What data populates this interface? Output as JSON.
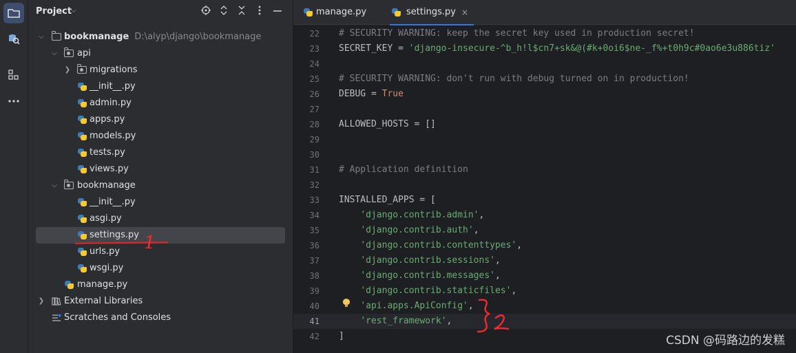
{
  "sidebar": {
    "title": "Project",
    "tree": [
      {
        "label": "bookmanage",
        "path": "D:\\alyp\\django\\bookmanage",
        "bold": true
      },
      {
        "label": "api"
      },
      {
        "label": "migrations"
      },
      {
        "label": "__init__.py"
      },
      {
        "label": "admin.py"
      },
      {
        "label": "apps.py"
      },
      {
        "label": "models.py"
      },
      {
        "label": "tests.py"
      },
      {
        "label": "views.py"
      },
      {
        "label": "bookmanage"
      },
      {
        "label": "__init__.py"
      },
      {
        "label": "asgi.py"
      },
      {
        "label": "settings.py"
      },
      {
        "label": "urls.py"
      },
      {
        "label": "wsgi.py"
      },
      {
        "label": "manage.py"
      },
      {
        "label": "External Libraries"
      },
      {
        "label": "Scratches and Consoles"
      }
    ]
  },
  "annotations": {
    "mark1": "1",
    "mark2": "}2"
  },
  "editor": {
    "tabs": [
      {
        "label": "manage.py"
      },
      {
        "label": "settings.py",
        "close": "×"
      }
    ],
    "line_numbers": [
      "22",
      "23",
      "24",
      "25",
      "26",
      "27",
      "28",
      "29",
      "30",
      "31",
      "32",
      "33",
      "34",
      "35",
      "36",
      "37",
      "38",
      "39",
      "40",
      "41",
      "42"
    ],
    "lines": [
      [
        {
          "t": "# SECURITY WARNING: keep the secret key used in production secret!",
          "c": "comment"
        }
      ],
      [
        {
          "t": "SECRET_KEY = ",
          "c": "plain"
        },
        {
          "t": "'django-insecure-^b_h!l$cn7+sk&@(#k+0oi6$ne-_f%+t0h9c#0ao6e3u886tiz'",
          "c": "str"
        }
      ],
      [],
      [
        {
          "t": "# SECURITY WARNING: don't run with debug turned on in production!",
          "c": "comment"
        }
      ],
      [
        {
          "t": "DEBUG = ",
          "c": "plain"
        },
        {
          "t": "True",
          "c": "kw"
        }
      ],
      [],
      [
        {
          "t": "ALLOWED_HOSTS = []",
          "c": "plain"
        }
      ],
      [],
      [],
      [
        {
          "t": "# Application definition",
          "c": "comment"
        }
      ],
      [],
      [
        {
          "t": "INSTALLED_APPS = [",
          "c": "plain"
        }
      ],
      [
        {
          "t": "    ",
          "c": "plain"
        },
        {
          "t": "'django.contrib.admin'",
          "c": "str"
        },
        {
          "t": ",",
          "c": "plain"
        }
      ],
      [
        {
          "t": "    ",
          "c": "plain"
        },
        {
          "t": "'django.contrib.auth'",
          "c": "str"
        },
        {
          "t": ",",
          "c": "plain"
        }
      ],
      [
        {
          "t": "    ",
          "c": "plain"
        },
        {
          "t": "'django.contrib.contenttypes'",
          "c": "str"
        },
        {
          "t": ",",
          "c": "plain"
        }
      ],
      [
        {
          "t": "    ",
          "c": "plain"
        },
        {
          "t": "'django.contrib.sessions'",
          "c": "str"
        },
        {
          "t": ",",
          "c": "plain"
        }
      ],
      [
        {
          "t": "    ",
          "c": "plain"
        },
        {
          "t": "'django.contrib.messages'",
          "c": "str"
        },
        {
          "t": ",",
          "c": "plain"
        }
      ],
      [
        {
          "t": "    ",
          "c": "plain"
        },
        {
          "t": "'django.contrib.staticfiles'",
          "c": "str"
        },
        {
          "t": ",",
          "c": "plain"
        }
      ],
      [
        {
          "t": "    ",
          "c": "plain"
        },
        {
          "t": "'api.apps.ApiConfig'",
          "c": "str"
        },
        {
          "t": ",",
          "c": "plain"
        }
      ],
      [
        {
          "t": "    ",
          "c": "plain"
        },
        {
          "t": "'rest_framework'",
          "c": "str"
        },
        {
          "t": ",",
          "c": "plain"
        }
      ],
      [
        {
          "t": "]",
          "c": "plain"
        }
      ]
    ]
  },
  "watermark": "CSDN @码路边的发糕",
  "colors": {
    "comment": "#7a7e85",
    "string": "#6aab73",
    "keyword": "#cf8e6d",
    "annotation_red": "#e8242a",
    "accent": "#3574f0"
  }
}
